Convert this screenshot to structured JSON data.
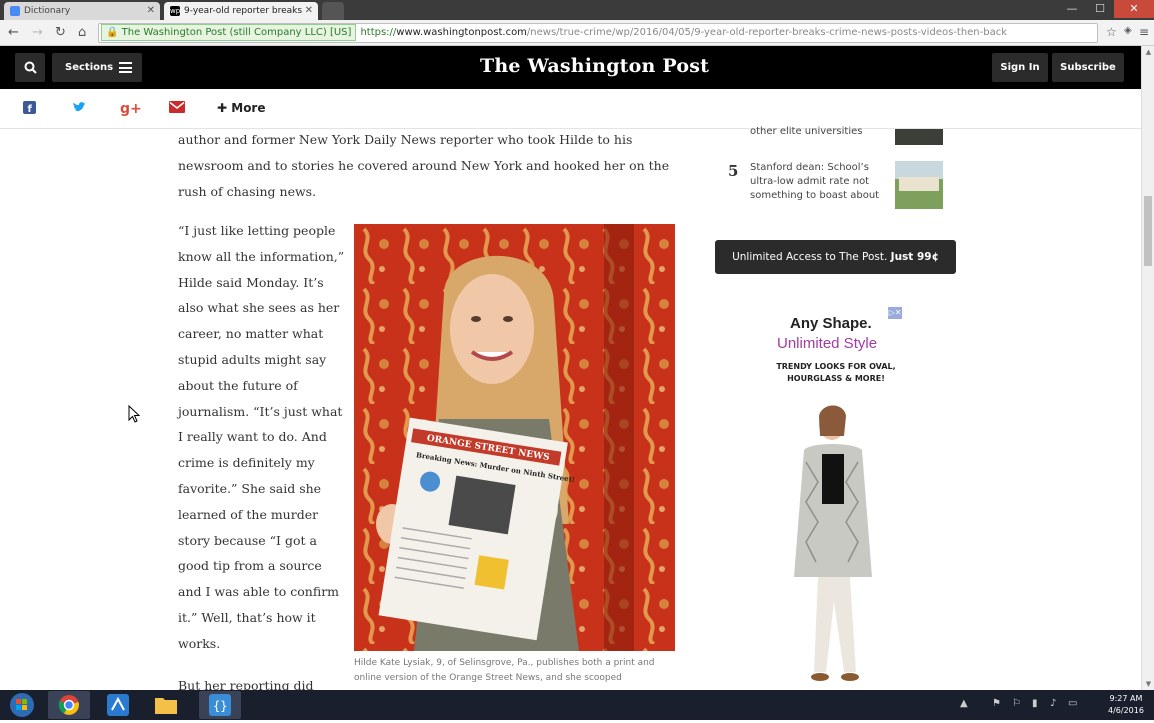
{
  "browser": {
    "tabs": [
      {
        "label": "Dictionary"
      },
      {
        "label": "9-year-old reporter breaks"
      }
    ],
    "ev_cert": "The Washington Post (still Company LLC) [US]",
    "url_https": "https://",
    "url_host": "www.washingtonpost.com",
    "url_path": "/news/true-crime/wp/2016/04/05/9-year-old-reporter-breaks-crime-news-posts-videos-then-back"
  },
  "header": {
    "sections_label": "Sections",
    "logo": "The Washington Post",
    "signin_label": "Sign In",
    "subscribe_label": "Subscribe"
  },
  "share": {
    "more_label": "More"
  },
  "article": {
    "intro": "author and former New York Daily News reporter who took Hilde to his newsroom and to stories he covered around New York and hooked her on the rush of chasing news.",
    "quote": "“I just like letting people know all the information,” Hilde said Monday. It’s also what she sees as her career, no matter what stupid adults might say about the future of journalism. “It’s just what I really want to do. And crime is definitely my favorite.” She said she learned of the murder story because “I got a good tip from a source and I was able to confirm it.” Well, that’s how it works.",
    "tail": "But her reporting did",
    "photo_paper_title": "ORANGE STREET NEWS",
    "photo_paper_headline": "Breaking News: Murder on Ninth Street!",
    "caption": "Hilde Kate Lysiak, 9, of Selinsgrove, Pa., publishes both a print and online version of the Orange Street News, and she scooped"
  },
  "sidebar": {
    "item4_tail": "other elite universities",
    "item5_num": "5",
    "item5_text": "Stanford dean: School’s ultra-low admit rate not something to boast about",
    "promo_text": "Unlimited Access to The Post.",
    "promo_price": "Just 99¢"
  },
  "ad": {
    "headline1": "Any Shape.",
    "headline2": "Unlimited Style",
    "small_text": "TRENDY LOOKS FOR OVAL, HOURGLASS & MORE!",
    "badge": "▷✕"
  },
  "taskbar": {
    "time": "9:27 AM",
    "date": "4/6/2016"
  },
  "colors": {
    "header_bg": "#000000",
    "facebook": "#3b5998",
    "twitter": "#1da1f2",
    "google": "#dd4b39",
    "email": "#cc2b2b",
    "ad_accent": "#a43aa5"
  }
}
